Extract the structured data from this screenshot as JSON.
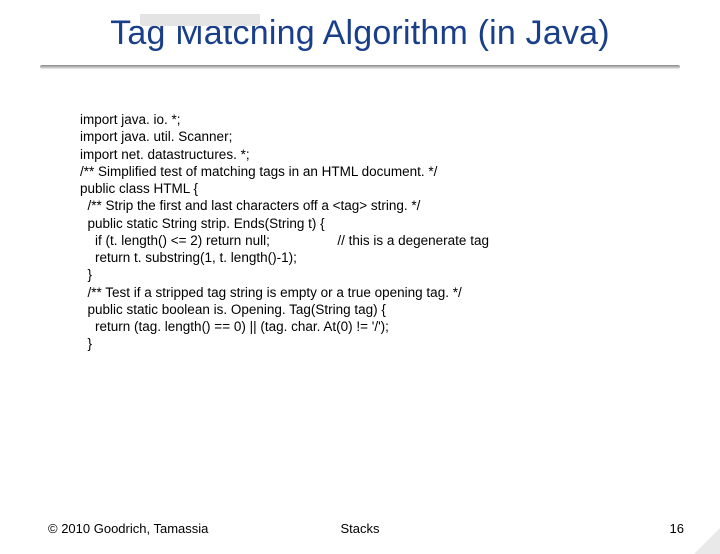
{
  "title": "Tag Matching Algorithm (in Java)",
  "code": {
    "l1": "import java. io. *;",
    "l2": "import java. util. Scanner;",
    "l3": "import net. datastructures. *;",
    "l4": "/** Simplified test of matching tags in an HTML document. */",
    "l5": "public class HTML {",
    "l6": "  /** Strip the first and last characters off a <tag> string. */",
    "l7": "  public static String strip. Ends(String t) {",
    "l8a": "    if (t. length() <= 2) return null;",
    "l8b": "// this is a degenerate tag",
    "l9": "    return t. substring(1, t. length()-1);",
    "l10": "  }",
    "l11": "  /** Test if a stripped tag string is empty or a true opening tag. */",
    "l12": "  public static boolean is. Opening. Tag(String tag) {",
    "l13": "    return (tag. length() == 0) || (tag. char. At(0) != '/');",
    "l14": "  }"
  },
  "footer": {
    "copyright": "© 2010 Goodrich, Tamassia",
    "center": "Stacks",
    "pagenum": "16"
  }
}
